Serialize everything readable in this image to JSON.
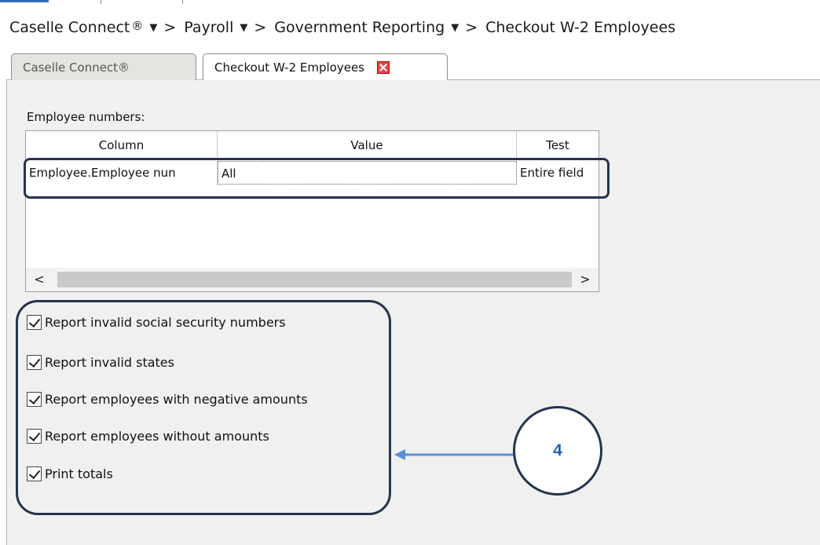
{
  "breadcrumb": {
    "items": [
      {
        "label": "Caselle Connect",
        "symbol": "®"
      },
      {
        "label": "Payroll"
      },
      {
        "label": "Government Reporting"
      },
      {
        "label": "Checkout W-2 Employees"
      }
    ],
    "dropdown_icon": "▼",
    "separator": ">"
  },
  "tabs": [
    {
      "label": "Caselle Connect®",
      "active": false
    },
    {
      "label": "Checkout W-2 Employees",
      "active": true,
      "closable": true
    }
  ],
  "employee_numbers": {
    "label": "Employee numbers:",
    "columns": [
      "Column",
      "Value",
      "Test"
    ],
    "rows": [
      {
        "column": "Employee.Employee nun",
        "value": "All",
        "test": "Entire field"
      }
    ],
    "scroll_left": "<",
    "scroll_right": ">"
  },
  "options": [
    {
      "label": "Report invalid social security numbers",
      "checked": true
    },
    {
      "label": "Report invalid states",
      "checked": true
    },
    {
      "label": "Report employees with negative amounts",
      "checked": true
    },
    {
      "label": "Report employees without amounts",
      "checked": true
    },
    {
      "label": "Print totals",
      "checked": true
    }
  ],
  "callout": {
    "number": "4"
  },
  "colors": {
    "accent": "#2f6db5",
    "annotation": "#24344d",
    "callout_text": "#1f62b4",
    "arrow": "#5b8fd1"
  }
}
